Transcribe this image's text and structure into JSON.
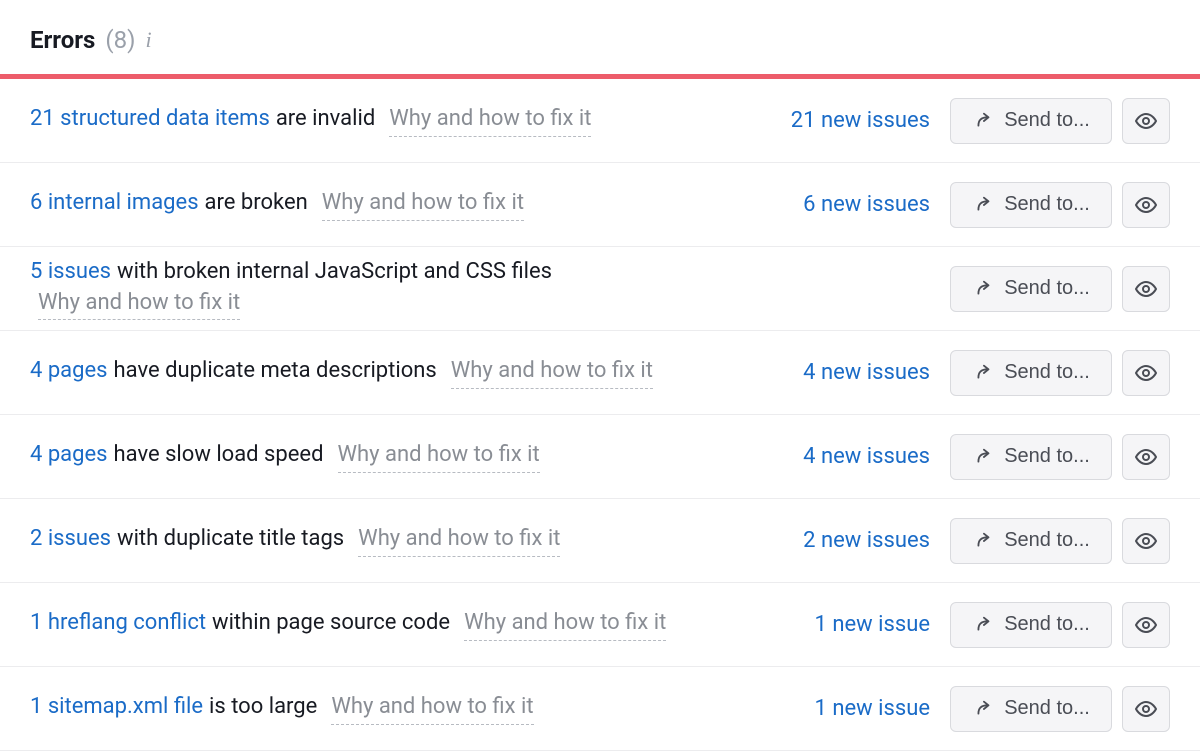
{
  "header": {
    "title": "Errors",
    "count_display": "(8)",
    "info_glyph": "i"
  },
  "accent_color": "#ed5c6a",
  "fix_link_label": "Why and how to fix it",
  "send_label": "Send to...",
  "issues": [
    {
      "link": "21 structured data items",
      "desc": "are invalid",
      "new_issues": "21 new issues"
    },
    {
      "link": "6 internal images",
      "desc": "are broken",
      "new_issues": "6 new issues"
    },
    {
      "link": "5 issues",
      "desc": "with broken internal JavaScript and CSS files",
      "new_issues": ""
    },
    {
      "link": "4 pages",
      "desc": "have duplicate meta descriptions",
      "new_issues": "4 new issues"
    },
    {
      "link": "4 pages",
      "desc": "have slow load speed",
      "new_issues": "4 new issues"
    },
    {
      "link": "2 issues",
      "desc": "with duplicate title tags",
      "new_issues": "2 new issues"
    },
    {
      "link": "1 hreflang conflict",
      "desc": "within page source code",
      "new_issues": "1 new issue"
    },
    {
      "link": "1 sitemap.xml file",
      "desc": "is too large",
      "new_issues": "1 new issue"
    }
  ]
}
